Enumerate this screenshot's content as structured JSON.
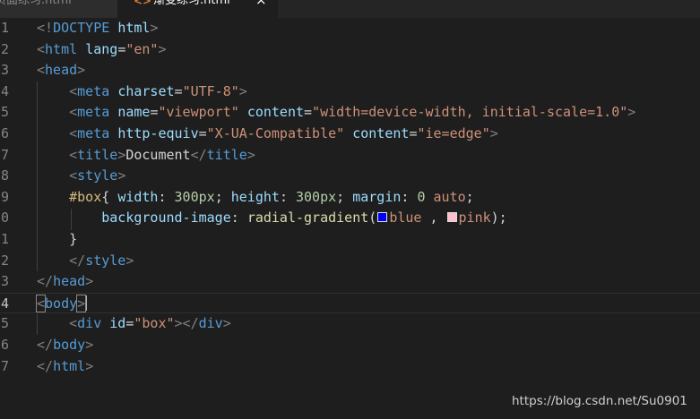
{
  "tabs": [
    {
      "label": "页面练习.html",
      "active": false
    },
    {
      "icon": "<>",
      "label": "渐变练习.html",
      "close": "×",
      "active": true
    }
  ],
  "editor": {
    "line_numbers": [
      "1",
      "2",
      "3",
      "4",
      "5",
      "6",
      "7",
      "8",
      "9",
      "0",
      "1",
      "2",
      "3",
      "4",
      "5",
      "6",
      "7"
    ],
    "active_line_index": 13,
    "lines": [
      [
        [
          "t-br",
          "<!"
        ],
        [
          "t-tag",
          "DOCTYPE"
        ],
        [
          "t-txt",
          " "
        ],
        [
          "t-attr",
          "html"
        ],
        [
          "t-br",
          ">"
        ]
      ],
      [
        [
          "t-br",
          "<"
        ],
        [
          "t-tag",
          "html"
        ],
        [
          "t-txt",
          " "
        ],
        [
          "t-attr",
          "lang"
        ],
        [
          "t-txt",
          "="
        ],
        [
          "t-str",
          "\"en\""
        ],
        [
          "t-br",
          ">"
        ]
      ],
      [
        [
          "t-br",
          "<"
        ],
        [
          "t-tag",
          "head"
        ],
        [
          "t-br",
          ">"
        ]
      ],
      [
        [
          "t-txt",
          "    "
        ],
        [
          "t-br",
          "<"
        ],
        [
          "t-tag",
          "meta"
        ],
        [
          "t-txt",
          " "
        ],
        [
          "t-attr",
          "charset"
        ],
        [
          "t-txt",
          "="
        ],
        [
          "t-str",
          "\"UTF-8\""
        ],
        [
          "t-br",
          ">"
        ]
      ],
      [
        [
          "t-txt",
          "    "
        ],
        [
          "t-br",
          "<"
        ],
        [
          "t-tag",
          "meta"
        ],
        [
          "t-txt",
          " "
        ],
        [
          "t-attr",
          "name"
        ],
        [
          "t-txt",
          "="
        ],
        [
          "t-str",
          "\"viewport\""
        ],
        [
          "t-txt",
          " "
        ],
        [
          "t-attr",
          "content"
        ],
        [
          "t-txt",
          "="
        ],
        [
          "t-str",
          "\"width=device-width, initial-scale=1.0\""
        ],
        [
          "t-br",
          ">"
        ]
      ],
      [
        [
          "t-txt",
          "    "
        ],
        [
          "t-br",
          "<"
        ],
        [
          "t-tag",
          "meta"
        ],
        [
          "t-txt",
          " "
        ],
        [
          "t-attr",
          "http-equiv"
        ],
        [
          "t-txt",
          "="
        ],
        [
          "t-str",
          "\"X-UA-Compatible\""
        ],
        [
          "t-txt",
          " "
        ],
        [
          "t-attr",
          "content"
        ],
        [
          "t-txt",
          "="
        ],
        [
          "t-str",
          "\"ie=edge\""
        ],
        [
          "t-br",
          ">"
        ]
      ],
      [
        [
          "t-txt",
          "    "
        ],
        [
          "t-br",
          "<"
        ],
        [
          "t-tag",
          "title"
        ],
        [
          "t-br",
          ">"
        ],
        [
          "t-txt",
          "Document"
        ],
        [
          "t-br",
          "</"
        ],
        [
          "t-tag",
          "title"
        ],
        [
          "t-br",
          ">"
        ]
      ],
      [
        [
          "t-txt",
          "    "
        ],
        [
          "t-br",
          "<"
        ],
        [
          "t-tag",
          "style"
        ],
        [
          "t-br",
          ">"
        ]
      ],
      [
        [
          "t-txt",
          "    "
        ],
        [
          "t-sel",
          "#box"
        ],
        [
          "t-txt",
          "{ "
        ],
        [
          "t-attr",
          "width"
        ],
        [
          "t-txt",
          ": "
        ],
        [
          "t-num",
          "300px"
        ],
        [
          "t-txt",
          "; "
        ],
        [
          "t-attr",
          "height"
        ],
        [
          "t-txt",
          ": "
        ],
        [
          "t-num",
          "300px"
        ],
        [
          "t-txt",
          "; "
        ],
        [
          "t-attr",
          "margin"
        ],
        [
          "t-txt",
          ": "
        ],
        [
          "t-num",
          "0"
        ],
        [
          "t-txt",
          " "
        ],
        [
          "t-str",
          "auto"
        ],
        [
          "t-txt",
          ";"
        ]
      ],
      [
        [
          "t-txt",
          "        "
        ],
        [
          "t-attr",
          "background-image"
        ],
        [
          "t-txt",
          ": "
        ],
        [
          "t-fn",
          "radial-gradient"
        ],
        [
          "t-txt",
          "("
        ],
        [
          "swatch",
          "#0000ff"
        ],
        [
          "t-str",
          "blue"
        ],
        [
          "t-txt",
          " , "
        ],
        [
          "swatch",
          "#ffc0cb"
        ],
        [
          "t-str",
          "pink"
        ],
        [
          "t-txt",
          ");"
        ]
      ],
      [
        [
          "t-txt",
          "    }"
        ]
      ],
      [
        [
          "t-txt",
          "    "
        ],
        [
          "t-br",
          "</"
        ],
        [
          "t-tag",
          "style"
        ],
        [
          "t-br",
          ">"
        ]
      ],
      [
        [
          "t-br",
          "</"
        ],
        [
          "t-tag",
          "head"
        ],
        [
          "t-br",
          ">"
        ]
      ],
      [
        [
          "t-br-match",
          "<"
        ],
        [
          "t-tag",
          "body"
        ],
        [
          "t-br-match",
          ">"
        ],
        [
          "cursor",
          ""
        ]
      ],
      [
        [
          "t-txt",
          "    "
        ],
        [
          "t-br",
          "<"
        ],
        [
          "t-tag",
          "div"
        ],
        [
          "t-txt",
          " "
        ],
        [
          "t-attr",
          "id"
        ],
        [
          "t-txt",
          "="
        ],
        [
          "t-str",
          "\"box\""
        ],
        [
          "t-br",
          "></"
        ],
        [
          "t-tag",
          "div"
        ],
        [
          "t-br",
          ">"
        ]
      ],
      [
        [
          "t-br",
          "</"
        ],
        [
          "t-tag",
          "body"
        ],
        [
          "t-br",
          ">"
        ]
      ],
      [
        [
          "t-br",
          "</"
        ],
        [
          "t-tag",
          "html"
        ],
        [
          "t-br",
          ">"
        ]
      ]
    ]
  },
  "watermark": "https://blog.csdn.net/Su0901",
  "colors": {
    "background": "#1e1e1e",
    "tag": "#569cd6",
    "attribute": "#9cdcfe",
    "string": "#ce9178",
    "number": "#b5cea8",
    "function": "#dcdcaa",
    "selector": "#d7ba7d"
  }
}
